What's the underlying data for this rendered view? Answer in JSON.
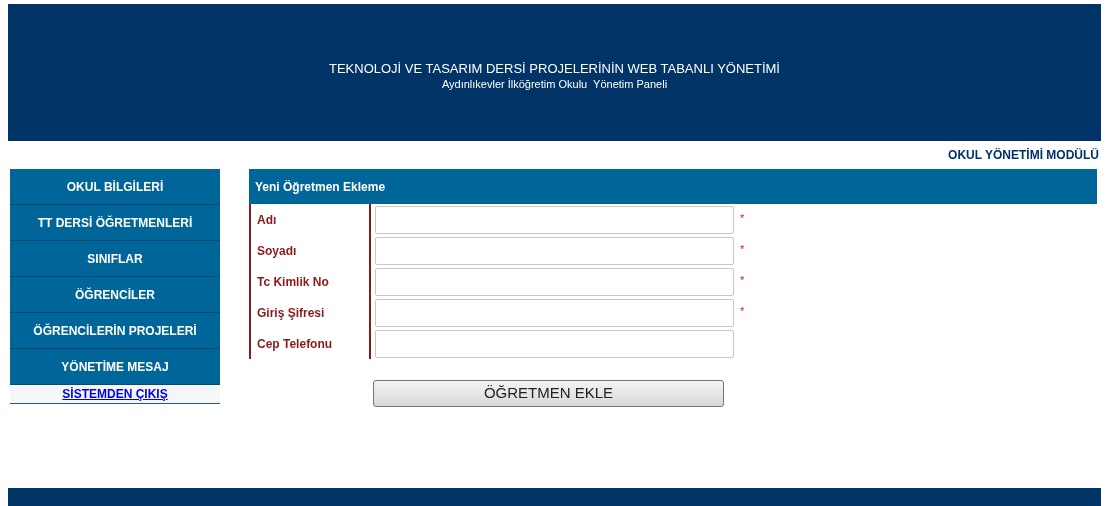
{
  "header": {
    "title": "TEKNOLOJİ VE TASARIM DERSİ PROJELERİNİN WEB TABANLI YÖNETİMİ",
    "subtitle": "Aydınlıkevler İlköğretim Okulu  Yönetim Paneli"
  },
  "module_title": "OKUL YÖNETİMİ MODÜLÜ",
  "sidebar": {
    "items": [
      {
        "label": "OKUL BİLGİLERİ",
        "kind": "menu"
      },
      {
        "label": "TT DERSİ ÖĞRETMENLERİ",
        "kind": "menu"
      },
      {
        "label": "SINIFLAR",
        "kind": "menu"
      },
      {
        "label": "ÖĞRENCİLER",
        "kind": "menu"
      },
      {
        "label": "ÖĞRENCİLERİN PROJELERİ",
        "kind": "menu"
      },
      {
        "label": "YÖNETİME MESAJ",
        "kind": "menu"
      },
      {
        "label": "SİSTEMDEN ÇIKIŞ",
        "kind": "link"
      }
    ]
  },
  "form": {
    "title": "Yeni Öğretmen Ekleme",
    "fields": [
      {
        "label": "Adı",
        "required": true
      },
      {
        "label": "Soyadı",
        "required": true
      },
      {
        "label": "Tc Kimlik No",
        "required": true
      },
      {
        "label": "Giriş Şifresi",
        "required": true
      },
      {
        "label": "Cep Telefonu",
        "required": false
      }
    ],
    "required_mark": "*",
    "submit": "ÖĞRETMEN EKLE"
  }
}
